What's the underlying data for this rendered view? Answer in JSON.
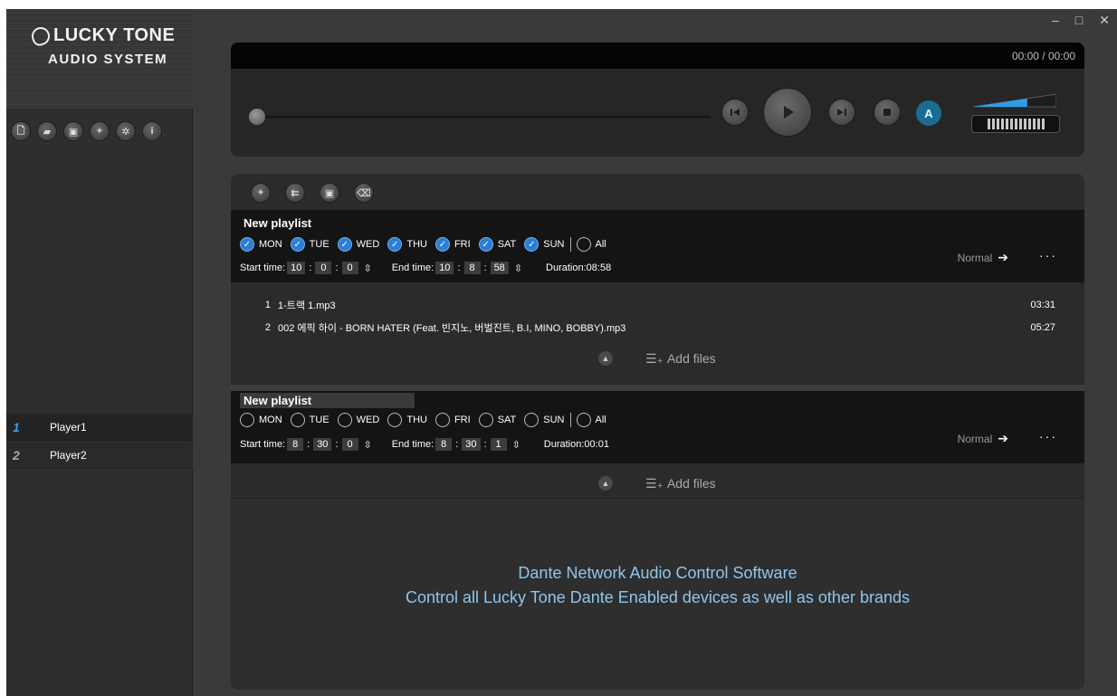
{
  "brand": {
    "line1": "LUCKY TONE",
    "line2": "AUDIO SYSTEM"
  },
  "sidebar_tools": [
    {
      "icon": "new-file-icon",
      "glyph": "🗋"
    },
    {
      "icon": "open-folder-icon",
      "glyph": "▰"
    },
    {
      "icon": "save-icon",
      "glyph": "▣"
    },
    {
      "icon": "add-icon",
      "glyph": "+"
    },
    {
      "icon": "settings-icon",
      "glyph": "✲"
    },
    {
      "icon": "info-icon",
      "glyph": "i"
    }
  ],
  "players": [
    {
      "num": "1",
      "label": "Player1"
    },
    {
      "num": "2",
      "label": "Player2"
    }
  ],
  "window_controls": {
    "minimize": "–",
    "maximize": "□",
    "close": "✕"
  },
  "transport": {
    "time": "00:00  /  00:00",
    "auto_label": "A",
    "volume_level": 0.65
  },
  "colors": {
    "accent": "#3d9be9",
    "promo_text": "#8fc6ec",
    "check_on": "#2b7ed6"
  },
  "playlists": [
    {
      "title": "New playlist",
      "days": [
        {
          "label": "MON",
          "checked": true
        },
        {
          "label": "TUE",
          "checked": true
        },
        {
          "label": "WED",
          "checked": true
        },
        {
          "label": "THU",
          "checked": true
        },
        {
          "label": "FRI",
          "checked": true
        },
        {
          "label": "SAT",
          "checked": true
        },
        {
          "label": "SUN",
          "checked": true
        }
      ],
      "all_label": "All",
      "start_label": "Start time:",
      "start": [
        "10",
        "0",
        "0"
      ],
      "end_label": "End time:",
      "end": [
        "10",
        "8",
        "58"
      ],
      "duration": "Duration:08:58",
      "mode": "Normal",
      "tracks": [
        {
          "num": "1",
          "name": "1-트랙 1.mp3",
          "dur": "03:31"
        },
        {
          "num": "2",
          "name": "002 에픽 하이 - BORN HATER (Feat. 빈지노, 버벌진트, B.I, MINO, BOBBY).mp3",
          "dur": "05:27"
        }
      ],
      "add_files": "Add files"
    },
    {
      "title": "New playlist",
      "days": [
        {
          "label": "MON",
          "checked": false
        },
        {
          "label": "TUE",
          "checked": false
        },
        {
          "label": "WED",
          "checked": false
        },
        {
          "label": "THU",
          "checked": false
        },
        {
          "label": "FRI",
          "checked": false
        },
        {
          "label": "SAT",
          "checked": false
        },
        {
          "label": "SUN",
          "checked": false
        }
      ],
      "all_label": "All",
      "start_label": "Start time:",
      "start": [
        "8",
        "30",
        "0"
      ],
      "end_label": "End time:",
      "end": [
        "8",
        "30",
        "1"
      ],
      "duration": "Duration:00:01",
      "mode": "Normal",
      "tracks": [],
      "add_files": "Add files"
    }
  ],
  "promo": {
    "line1": "Dante Network Audio Control Software",
    "line2": "Control all Lucky Tone Dante Enabled devices as well as other brands"
  }
}
